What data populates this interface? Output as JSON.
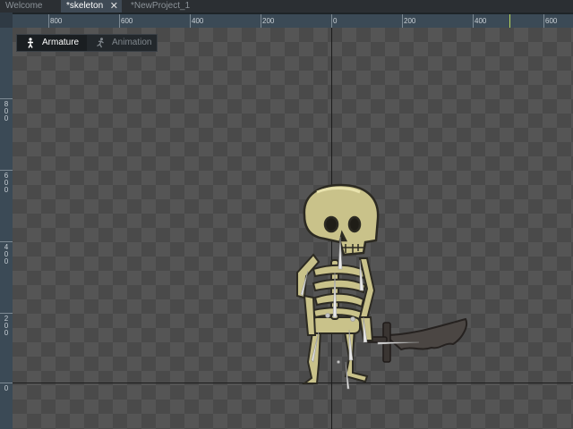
{
  "tabs": [
    {
      "label": "Welcome"
    },
    {
      "label": "*skeleton"
    },
    {
      "label": "*NewProject_1"
    }
  ],
  "close_glyph": "✕",
  "ruler": {
    "horizontal": [
      "800",
      "600",
      "400",
      "200",
      "0",
      "200",
      "400",
      "600"
    ],
    "vertical": [
      "800",
      "600",
      "400",
      "200",
      "0"
    ]
  },
  "mode": {
    "armature_label": "Armature",
    "animation_label": "Animation",
    "armature_icon": "armature-figure-icon",
    "animation_icon": "running-figure-icon"
  },
  "colors": {
    "accent": "#3f4a55",
    "bone": "#c9c28a",
    "outline": "#2c2a22"
  }
}
